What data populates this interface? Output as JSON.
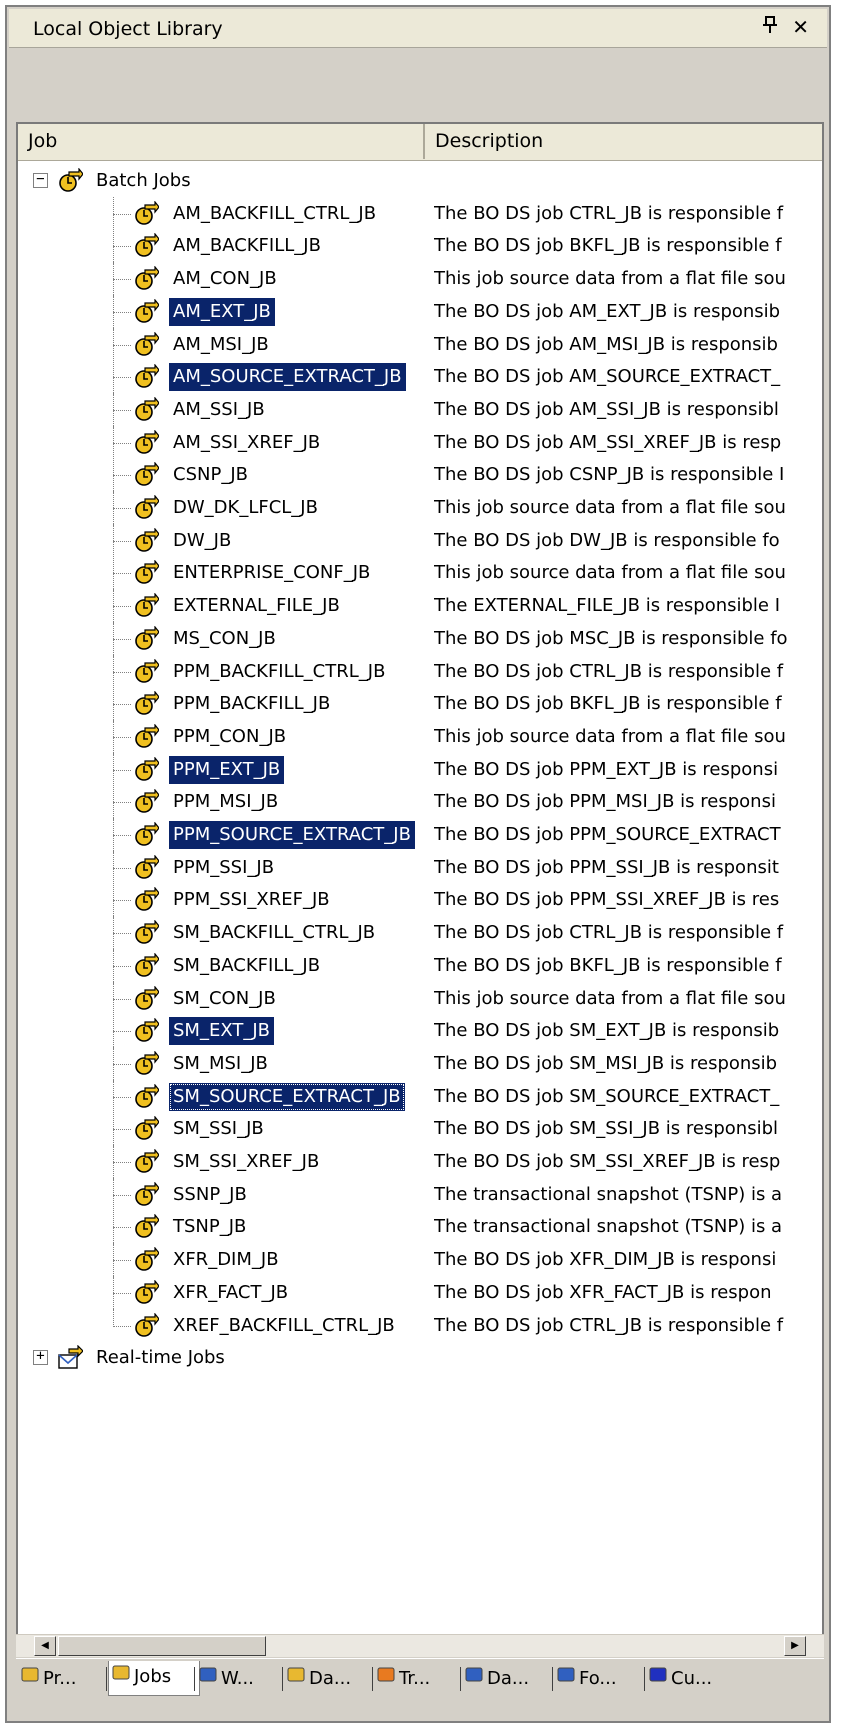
{
  "panel": {
    "title": "Local Object Library",
    "pin_symbol": "■",
    "close_symbol": "✕"
  },
  "columns": {
    "job": "Job",
    "description": "Description"
  },
  "tree": {
    "root": {
      "label": "Batch Jobs",
      "expander": "−",
      "icon": "batch-job-icon"
    },
    "items": [
      {
        "name": "AM_BACKFILL_CTRL_JB",
        "description": "The BO DS job CTRL_JB is responsible f",
        "selected": false
      },
      {
        "name": "AM_BACKFILL_JB",
        "description": "The BO DS job BKFL_JB is responsible f",
        "selected": false
      },
      {
        "name": "AM_CON_JB",
        "description": "This job source data from a flat file sou",
        "selected": false
      },
      {
        "name": "AM_EXT_JB",
        "description": "The BO DS job AM_EXT_JB is responsib",
        "selected": true
      },
      {
        "name": "AM_MSI_JB",
        "description": "The BO DS job AM_MSI_JB is responsib",
        "selected": false
      },
      {
        "name": "AM_SOURCE_EXTRACT_JB",
        "description": "The BO DS job AM_SOURCE_EXTRACT_",
        "selected": true
      },
      {
        "name": "AM_SSI_JB",
        "description": "The BO DS job AM_SSI_JB is responsibl",
        "selected": false
      },
      {
        "name": "AM_SSI_XREF_JB",
        "description": "The BO DS job AM_SSI_XREF_JB is resp",
        "selected": false
      },
      {
        "name": "CSNP_JB",
        "description": "The BO DS job CSNP_JB is responsible I",
        "selected": false
      },
      {
        "name": "DW_DK_LFCL_JB",
        "description": "This job source data from a flat file sou",
        "selected": false
      },
      {
        "name": "DW_JB",
        "description": "The BO DS job DW_JB is responsible fo",
        "selected": false
      },
      {
        "name": "ENTERPRISE_CONF_JB",
        "description": "This job source data from a flat file sou",
        "selected": false
      },
      {
        "name": "EXTERNAL_FILE_JB",
        "description": "The EXTERNAL_FILE_JB is responsible I",
        "selected": false
      },
      {
        "name": "MS_CON_JB",
        "description": "The BO DS job MSC_JB is responsible fo",
        "selected": false
      },
      {
        "name": "PPM_BACKFILL_CTRL_JB",
        "description": "The BO DS job CTRL_JB is responsible f",
        "selected": false
      },
      {
        "name": "PPM_BACKFILL_JB",
        "description": "The BO DS job BKFL_JB is responsible f",
        "selected": false
      },
      {
        "name": "PPM_CON_JB",
        "description": "This job source data from a flat file sou",
        "selected": false
      },
      {
        "name": "PPM_EXT_JB",
        "description": "The BO DS job PPM_EXT_JB is responsi",
        "selected": true
      },
      {
        "name": "PPM_MSI_JB",
        "description": "The BO DS job PPM_MSI_JB is responsi",
        "selected": false
      },
      {
        "name": "PPM_SOURCE_EXTRACT_JB",
        "description": "The BO DS job PPM_SOURCE_EXTRACT",
        "selected": true
      },
      {
        "name": "PPM_SSI_JB",
        "description": "The BO DS job PPM_SSI_JB is responsit",
        "selected": false
      },
      {
        "name": "PPM_SSI_XREF_JB",
        "description": "The BO DS job PPM_SSI_XREF_JB is res",
        "selected": false
      },
      {
        "name": "SM_BACKFILL_CTRL_JB",
        "description": "The BO DS job CTRL_JB is responsible f",
        "selected": false
      },
      {
        "name": "SM_BACKFILL_JB",
        "description": "The BO DS job BKFL_JB is responsible f",
        "selected": false
      },
      {
        "name": "SM_CON_JB",
        "description": "This job source data from a flat file sou",
        "selected": false
      },
      {
        "name": "SM_EXT_JB",
        "description": "The BO DS job SM_EXT_JB is responsib",
        "selected": true
      },
      {
        "name": "SM_MSI_JB",
        "description": "The BO DS job SM_MSI_JB is responsib",
        "selected": false
      },
      {
        "name": "SM_SOURCE_EXTRACT_JB",
        "description": "The BO DS job SM_SOURCE_EXTRACT_",
        "selected": true,
        "focused": true
      },
      {
        "name": "SM_SSI_JB",
        "description": "The BO DS job SM_SSI_JB is responsibl",
        "selected": false
      },
      {
        "name": "SM_SSI_XREF_JB",
        "description": "The BO DS job SM_SSI_XREF_JB is resp",
        "selected": false
      },
      {
        "name": "SSNP_JB",
        "description": "The transactional snapshot (TSNP) is a",
        "selected": false
      },
      {
        "name": "TSNP_JB",
        "description": "The transactional snapshot (TSNP) is a",
        "selected": false
      },
      {
        "name": "XFR_DIM_JB",
        "description": "The BO DS job XFR_DIM_JB is responsi",
        "selected": false
      },
      {
        "name": "XFR_FACT_JB",
        "description": "The BO DS job XFR_FACT_JB is respon",
        "selected": false
      },
      {
        "name": "XREF_BACKFILL_CTRL_JB",
        "description": "The BO DS job CTRL_JB is responsible f",
        "selected": false
      }
    ],
    "realtime": {
      "label": "Real-time Jobs",
      "expander": "+",
      "icon": "realtime-job-icon"
    }
  },
  "scrollbar": {
    "left_arrow": "◀",
    "right_arrow": "▶"
  },
  "tabs": [
    {
      "label": "Pr...",
      "icon": "folder-icon",
      "color": "#e8b830"
    },
    {
      "label": "Jobs",
      "icon": "job-icon",
      "color": "#e8b830",
      "active": true
    },
    {
      "label": "W...",
      "icon": "workflow-icon",
      "color": "#3060c0"
    },
    {
      "label": "Da...",
      "icon": "dataflow-icon",
      "color": "#e8b830"
    },
    {
      "label": "Tr...",
      "icon": "transform-icon",
      "color": "#e87a20"
    },
    {
      "label": "Da...",
      "icon": "datastore-icon",
      "color": "#3060c0"
    },
    {
      "label": "Fo...",
      "icon": "format-icon",
      "color": "#3060c0"
    },
    {
      "label": "Cu...",
      "icon": "custom-function-icon",
      "color": "#2030c0"
    }
  ],
  "colors": {
    "selection": "#0a246a",
    "panel": "#d4d0c8",
    "job_icon": "#f0c020"
  }
}
